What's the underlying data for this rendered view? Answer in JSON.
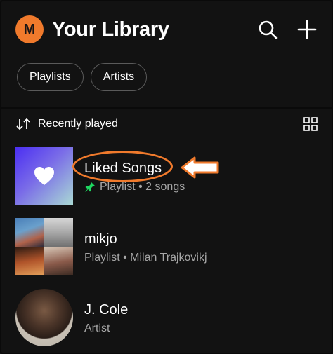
{
  "header": {
    "avatar_letter": "M",
    "title": "Your Library",
    "search_icon": "search-icon",
    "add_icon": "plus-icon"
  },
  "filters": [
    {
      "label": "Playlists"
    },
    {
      "label": "Artists"
    }
  ],
  "sort": {
    "label": "Recently played",
    "sort_icon": "sort-arrows-icon",
    "view_icon": "grid-view-icon"
  },
  "items": [
    {
      "name": "Liked Songs",
      "type": "Playlist",
      "detail": "2 songs",
      "pinned": true
    },
    {
      "name": "mikjo",
      "type": "Playlist",
      "detail": "Milan Trajkovikj",
      "pinned": false
    },
    {
      "name": "J. Cole",
      "type": "Artist",
      "detail": "",
      "pinned": false
    }
  ],
  "items_sub": {
    "liked": "Playlist • 2 songs",
    "mikjo": "Playlist • Milan Trajkovikj",
    "jcole": "Artist"
  },
  "colors": {
    "background": "#121212",
    "accent_avatar": "#f07a2c",
    "annotation": "#f07a2c",
    "pin": "#1ed760"
  }
}
